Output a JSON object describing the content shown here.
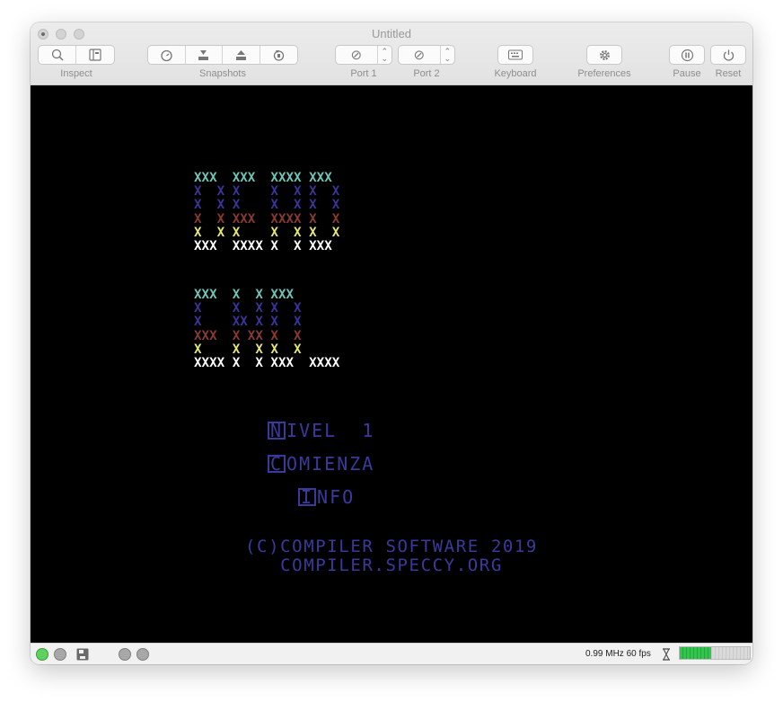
{
  "window": {
    "title": "Untitled"
  },
  "toolbar": {
    "inspect_label": "Inspect",
    "snapshots_label": "Snapshots",
    "port1_label": "Port 1",
    "port2_label": "Port 2",
    "keyboard_label": "Keyboard",
    "preferences_label": "Preferences",
    "pause_label": "Pause",
    "reset_label": "Reset",
    "port1_glyph": "⊘",
    "port2_glyph": "⊘",
    "icons": [
      "magnifier-icon",
      "inspect-panel-icon",
      "timer-icon",
      "take-snapshot-icon",
      "restore-snapshot-icon",
      "revert-icon",
      "no-device-icon",
      "keyboard-icon",
      "gear-icon",
      "pause-icon",
      "power-icon"
    ]
  },
  "screen": {
    "logo_colors": [
      "#6fc6b8",
      "#3a3598",
      "#8a3a33",
      "#e6e675",
      "#ffffff"
    ],
    "logo_rows": [
      "XXX  XXX  XXXX XXX ",
      "X  X X    X  X X  X",
      "X  X X    X  X X  X",
      "X  X XXX  XXXX X  X",
      "X  X X    X  X X  X",
      "XXX  XXXX X  X XXX ",
      "XXX  X  X XXX      ",
      "X    X  X X  X     ",
      "X    XX X X  X     ",
      "XXX  X XX X  X     ",
      "X    X  X X  X     ",
      "XXXX X  X XXX  XXXX"
    ],
    "menu": [
      {
        "key": "N",
        "rest": "IVEL  1"
      },
      {
        "key": "C",
        "rest": "OMIENZA"
      },
      {
        "key": "I",
        "rest": "NFO"
      }
    ],
    "credit_line1": "(C)COMPILER SOFTWARE 2019",
    "credit_line2": "COMPILER.SPECCY.ORG",
    "text_color": "#3a3a9c"
  },
  "statusbar": {
    "speed_text": "0.99 MHz 60 fps",
    "speed_fraction": 0.45,
    "icons": [
      "drive-led-icon",
      "drive-led-icon",
      "disk-icon",
      "drive-led-icon",
      "drive-led-icon",
      "hourglass-icon"
    ]
  }
}
